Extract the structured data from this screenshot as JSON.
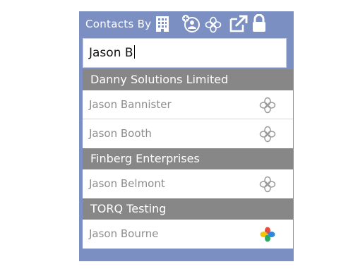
{
  "header": {
    "title": "Contacts By",
    "icons": [
      "building-icon",
      "add-contact-icon",
      "clover-icon",
      "external-link-icon",
      "lock-icon"
    ]
  },
  "search": {
    "value": "Jason B"
  },
  "groups": [
    {
      "name": "Danny Solutions Limited",
      "contacts": [
        {
          "name": "Jason Bannister",
          "icon": "clover-outline-icon"
        },
        {
          "name": "Jason Booth",
          "icon": "clover-outline-icon"
        }
      ]
    },
    {
      "name": "Finberg Enterprises",
      "contacts": [
        {
          "name": "Jason Belmont",
          "icon": "clover-outline-icon"
        }
      ]
    },
    {
      "name": "TORQ Testing",
      "contacts": [
        {
          "name": "Jason Bourne",
          "icon": "clover-color-icon"
        }
      ]
    }
  ],
  "colors": {
    "panel": "#7b8fc2",
    "group_header": "#878787",
    "contact_text": "#8d8d8d",
    "clover_colors": [
      "#e84c3d",
      "#2e86de",
      "#f1c40f",
      "#27ae60"
    ]
  }
}
